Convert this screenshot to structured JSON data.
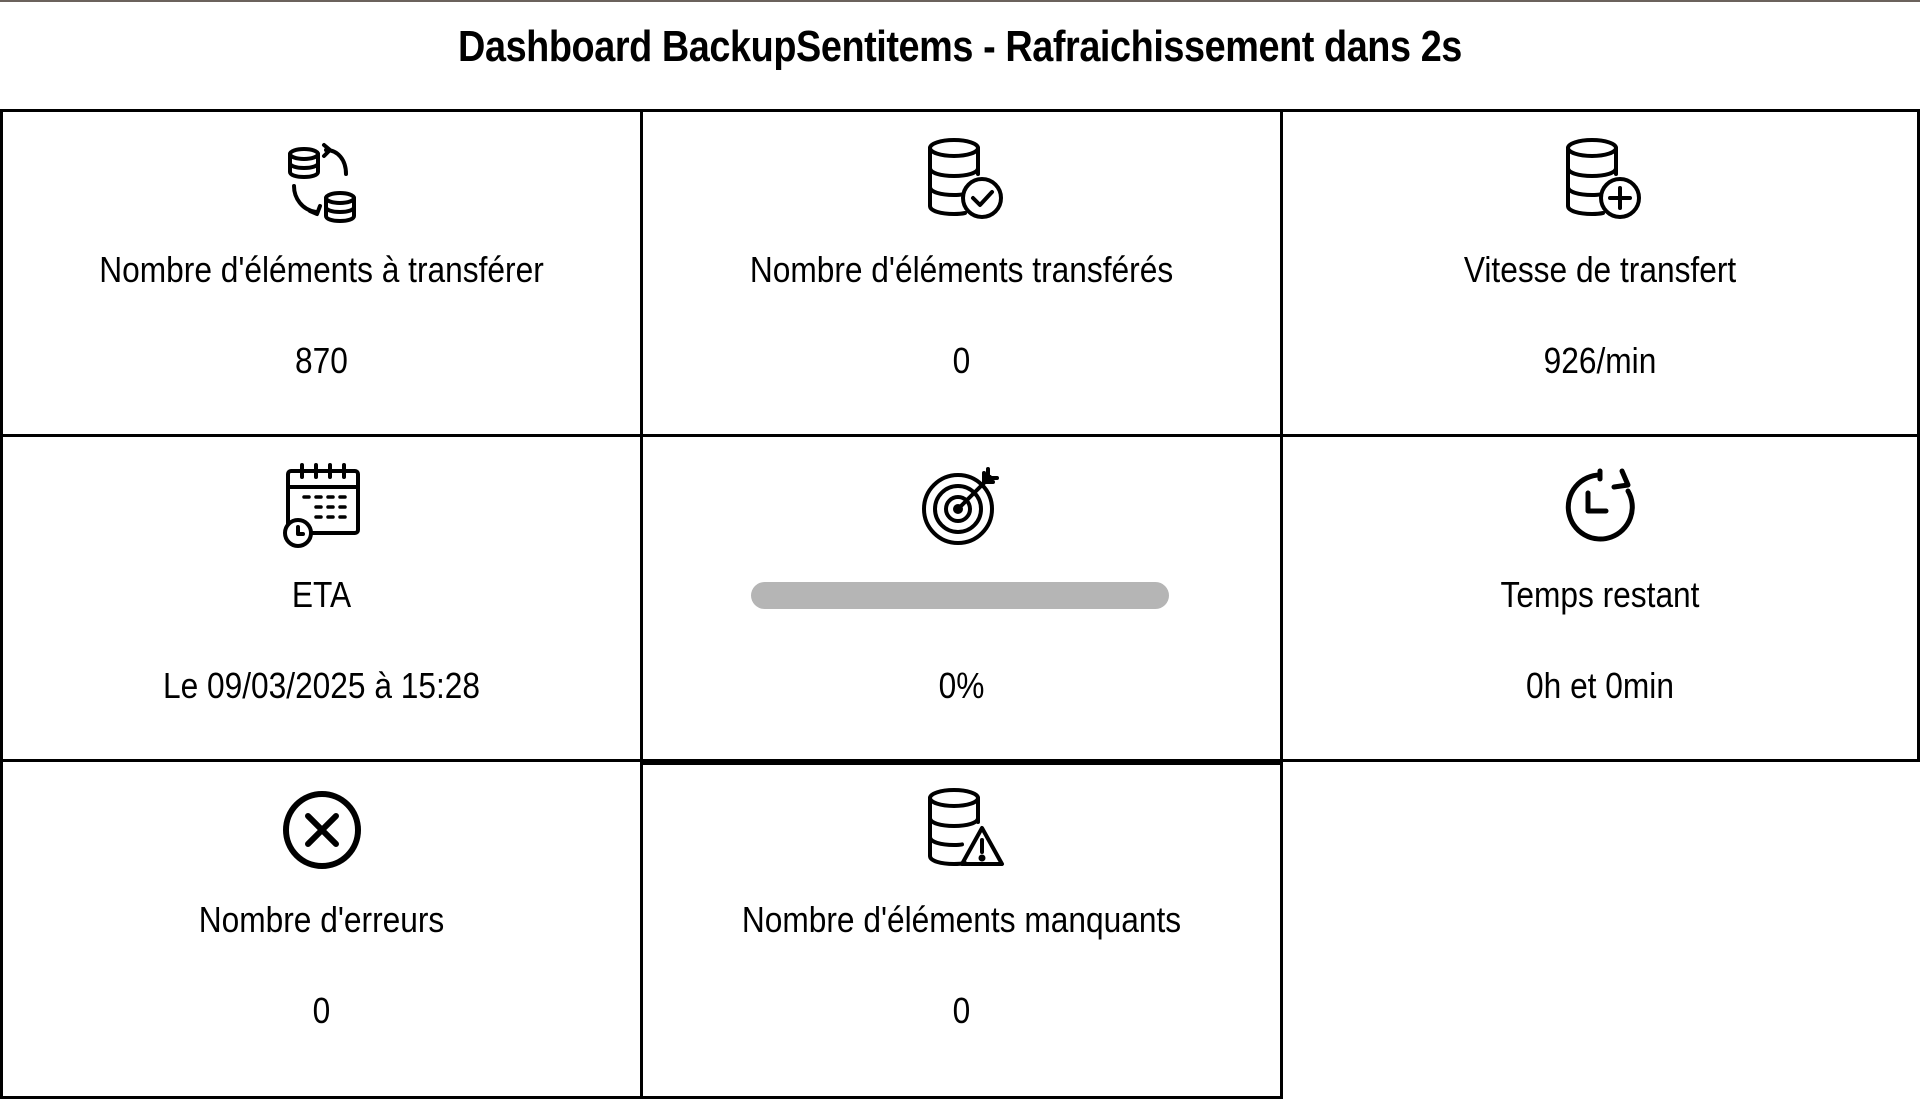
{
  "header": {
    "title": "Dashboard BackupSentitems - Rafraichissement dans 2s"
  },
  "cards": [
    {
      "icon": "database-transfer-icon",
      "label": "Nombre d'éléments à transférer",
      "value": "870"
    },
    {
      "icon": "database-check-icon",
      "label": "Nombre d'éléments transférés",
      "value": "0"
    },
    {
      "icon": "database-add-icon",
      "label": "Vitesse de transfert",
      "value": "926/min"
    },
    {
      "icon": "calendar-clock-icon",
      "label": "ETA",
      "value": "Le 09/03/2025 à 15:28"
    },
    {
      "icon": "target-icon",
      "label": "",
      "value": "0%",
      "progress_fraction": 0.0
    },
    {
      "icon": "timer-icon",
      "label": "Temps restant",
      "value": "0h et 0min"
    },
    {
      "icon": "error-x-icon",
      "label": "Nombre d'erreurs",
      "value": "0"
    },
    {
      "icon": "database-warning-icon",
      "label": "Nombre d'éléments manquants",
      "value": "0"
    }
  ],
  "colors": {
    "border": "#000000",
    "progress_track": "#b5b5b5",
    "background": "#ffffff"
  }
}
